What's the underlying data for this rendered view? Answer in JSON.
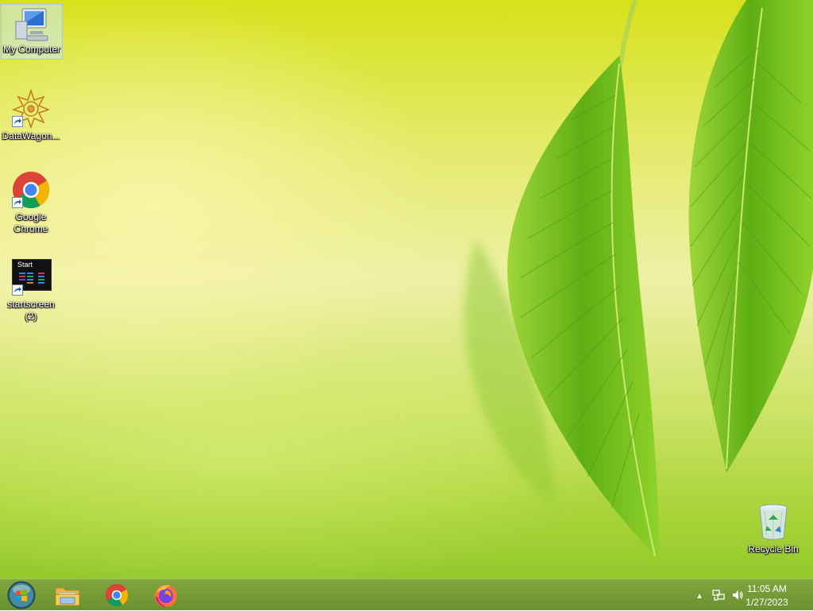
{
  "desktop": {
    "icons": [
      {
        "label": "My Computer",
        "icon": "computer-icon"
      },
      {
        "label": "DataWagon...",
        "icon": "datawagon-icon"
      },
      {
        "label": "Google Chrome",
        "icon": "chrome-icon"
      },
      {
        "label": "startscreen (2)",
        "icon": "startscreen-icon",
        "thumb_text": "Start"
      },
      {
        "label": "Recycle Bin",
        "icon": "recycle-bin-icon"
      }
    ]
  },
  "taskbar": {
    "pinned": [
      {
        "name": "start-button",
        "icon": "windows-orb-icon"
      },
      {
        "name": "file-explorer",
        "icon": "folder-icon"
      },
      {
        "name": "google-chrome",
        "icon": "chrome-icon"
      },
      {
        "name": "firefox",
        "icon": "firefox-icon"
      }
    ],
    "tray": {
      "show_hidden_arrow": "▴",
      "time": "11:05 AM",
      "date": "1/27/2023"
    }
  },
  "colors": {
    "taskbar": "#76a030",
    "wallpaper_top": "#d6e21a",
    "leaf": "#6fbf1e"
  }
}
